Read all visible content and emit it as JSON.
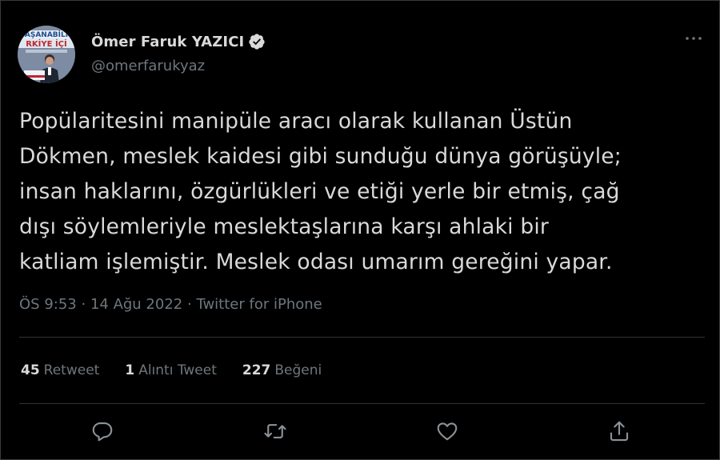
{
  "tweet": {
    "display_name": "Ömer Faruk YAZICI",
    "handle": "@omerfarukyaz",
    "verified": true,
    "lines": [
      "Popülaritesini manipüle aracı olarak kullanan Üstün",
      "Dökmen, meslek kaidesi gibi sunduğu dünya görüşüyle;",
      "insan haklarını, özgürlükleri ve etiği yerle bir etmiş, çağ",
      "dışı söylemleriyle meslektaşlarına karşı ahlaki bir",
      "katliam işlemiştir. Meslek odası umarım gereğini yapar."
    ],
    "time": "ÖS 9:53",
    "separator": "·",
    "date": "14 Ağu 2022",
    "source": "Twitter for iPhone"
  },
  "avatar": {
    "banner_text_top": "AŞANABİLİ",
    "banner_text_bottom": "RKİYE İÇİ"
  },
  "stats": {
    "retweets": {
      "count": "45",
      "label": "Retweet"
    },
    "quotes": {
      "count": "1",
      "label": "Alıntı Tweet"
    },
    "likes": {
      "count": "227",
      "label": "Beğeni"
    }
  },
  "icons": {
    "more": "more-horizontal-icon",
    "reply": "reply-icon",
    "retweet": "retweet-icon",
    "like": "heart-icon",
    "share": "share-icon",
    "verified": "verified-badge-icon"
  },
  "colors": {
    "background": "#000000",
    "text": "#d9d9d9",
    "secondary": "#6e767d",
    "divider": "#2f3336",
    "verified_badge": "#d9d9d9"
  }
}
